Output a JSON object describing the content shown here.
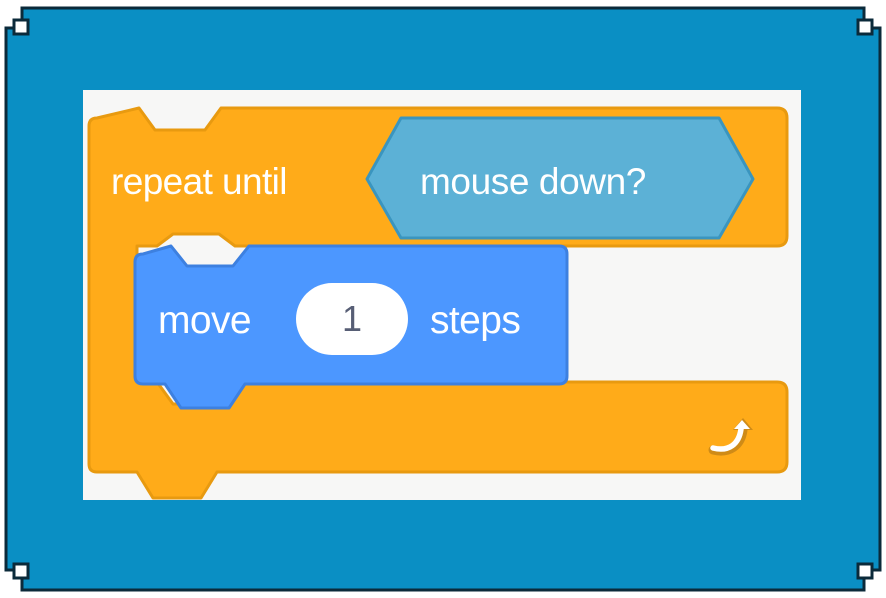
{
  "colors": {
    "frame": "#0a8fc4",
    "frame_border": "#0b2a3a",
    "control_block": "#ffab19",
    "control_border": "#e89a10",
    "sensing_block": "#5cb1d6",
    "motion_block": "#4c97ff",
    "canvas": "#f7f7f6"
  },
  "repeat_block": {
    "label": "repeat until",
    "icon": "loop-arrow-icon"
  },
  "condition_block": {
    "label": "mouse down?"
  },
  "move_block": {
    "prefix": "move",
    "value": "1",
    "suffix": "steps"
  }
}
